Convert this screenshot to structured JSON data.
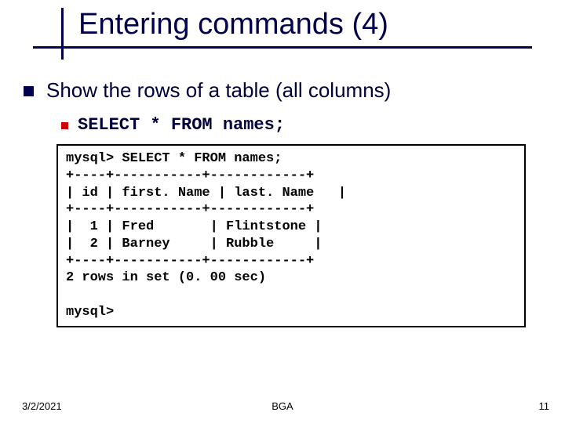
{
  "title": "Entering commands (4)",
  "top_bullet": "Show the rows of a table (all columns)",
  "sub_bullet": "SELECT * FROM names;",
  "code": {
    "l0": "mysql> SELECT * FROM names;",
    "l1": "+----+-----------+------------+",
    "l2": "| id | first. Name | last. Name   |",
    "l3": "+----+-----------+------------+",
    "l4": "|  1 | Fred       | Flintstone |",
    "l5": "|  2 | Barney     | Rubble     |",
    "l6": "+----+-----------+------------+",
    "l7": "2 rows in set (0. 00 sec)",
    "l8": "",
    "l9": "mysql>"
  },
  "footer": {
    "date": "3/2/2021",
    "center": "BGA",
    "page": "11"
  },
  "chart_data": {
    "type": "table",
    "title": "names",
    "columns": [
      "id",
      "first. Name",
      "last. Name"
    ],
    "rows": [
      [
        1,
        "Fred",
        "Flintstone"
      ],
      [
        2,
        "Barney",
        "Rubble"
      ]
    ],
    "row_count_text": "2 rows in set (0. 00 sec)"
  }
}
